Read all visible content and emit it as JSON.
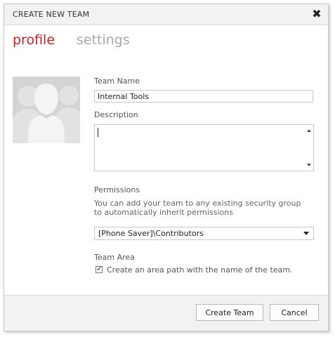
{
  "dialog": {
    "title": "CREATE NEW TEAM",
    "close_label": "✖"
  },
  "tabs": [
    {
      "label": "profile",
      "active": true
    },
    {
      "label": "settings",
      "active": false
    }
  ],
  "form": {
    "team_name_label": "Team Name",
    "team_name_value": "Internal Tools",
    "description_label": "Description",
    "description_value": "",
    "permissions_label": "Permissions",
    "permissions_help": "You can add your team to any existing security group to automatically inherit permissions",
    "permissions_value": "[Phone Saver]\\Contributors",
    "team_area_label": "Team Area",
    "area_checkbox_label": "Create an area path with the name of the team.",
    "area_checkbox_checked": true
  },
  "buttons": {
    "create": "Create Team",
    "cancel": "Cancel"
  },
  "colors": {
    "accent": "#cc2222",
    "inactive_tab": "#a9a9a9",
    "header_bg": "#f2f2f2"
  }
}
